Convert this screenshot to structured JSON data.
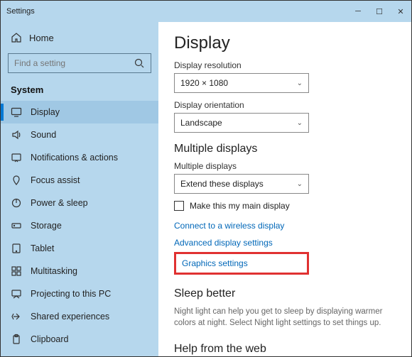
{
  "window": {
    "title": "Settings"
  },
  "sidebar": {
    "home": "Home",
    "search_placeholder": "Find a setting",
    "section": "System",
    "items": [
      {
        "label": "Display"
      },
      {
        "label": "Sound"
      },
      {
        "label": "Notifications & actions"
      },
      {
        "label": "Focus assist"
      },
      {
        "label": "Power & sleep"
      },
      {
        "label": "Storage"
      },
      {
        "label": "Tablet"
      },
      {
        "label": "Multitasking"
      },
      {
        "label": "Projecting to this PC"
      },
      {
        "label": "Shared experiences"
      },
      {
        "label": "Clipboard"
      }
    ]
  },
  "main": {
    "title": "Display",
    "resolution_label": "Display resolution",
    "resolution_value": "1920 × 1080",
    "orientation_label": "Display orientation",
    "orientation_value": "Landscape",
    "multiple_heading": "Multiple displays",
    "multiple_label": "Multiple displays",
    "multiple_value": "Extend these displays",
    "main_display_checkbox": "Make this my main display",
    "link_wireless": "Connect to a wireless display",
    "link_advanced": "Advanced display settings",
    "link_graphics": "Graphics settings",
    "sleep_heading": "Sleep better",
    "sleep_desc": "Night light can help you get to sleep by displaying warmer colors at night. Select Night light settings to set things up.",
    "help_heading": "Help from the web"
  }
}
